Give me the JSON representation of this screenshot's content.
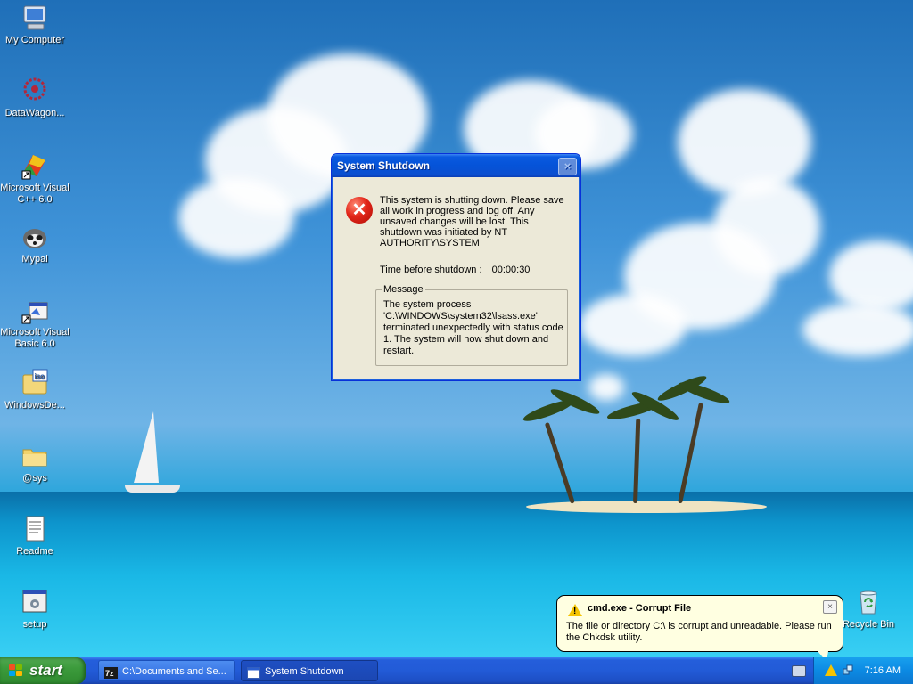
{
  "desktop": {
    "icons": [
      {
        "label": "My Computer",
        "icon": "my-computer-icon"
      },
      {
        "label": "DataWagon...",
        "icon": "datawagon-icon"
      },
      {
        "label": "Microsoft Visual C++ 6.0",
        "icon": "visual-cpp-icon"
      },
      {
        "label": "Mypal",
        "icon": "mypal-browser-icon"
      },
      {
        "label": "Microsoft Visual Basic 6.0",
        "icon": "visual-basic-icon"
      },
      {
        "label": "WindowsDe...",
        "icon": "iso-file-icon"
      },
      {
        "label": "@sys",
        "icon": "folder-icon"
      },
      {
        "label": "Readme",
        "icon": "text-document-icon"
      },
      {
        "label": "setup",
        "icon": "setup-icon"
      },
      {
        "label": "Recycle Bin",
        "icon": "recycle-bin-icon"
      }
    ]
  },
  "dialog": {
    "title": "System Shutdown",
    "close_label": "×",
    "message": "This system is shutting down. Please save all work in progress and log off. Any unsaved changes will be lost. This shutdown was initiated by NT AUTHORITY\\SYSTEM",
    "time_label": "Time before shutdown :",
    "time_value": "00:00:30",
    "group_label": "Message",
    "group_text": "The system process 'C:\\WINDOWS\\system32\\lsass.exe' terminated unexpectedly with status code 1.  The system will now shut down and restart."
  },
  "balloon": {
    "title": "cmd.exe - Corrupt File",
    "text": "The file or directory C:\\ is corrupt and unreadable. Please run the Chkdsk utility.",
    "close_label": "×"
  },
  "taskbar": {
    "start_label": "start",
    "buttons": [
      {
        "label": "C:\\Documents and Se...",
        "icon": "7zip-icon"
      },
      {
        "label": "System Shutdown",
        "icon": "window-icon"
      }
    ],
    "clock": "7:16 AM"
  },
  "colors": {
    "titlebar": "#0553d8",
    "taskbar": "#245edb",
    "start": "#3c9b3c",
    "tray": "#0c8ae3",
    "balloon": "#ffffe1"
  }
}
